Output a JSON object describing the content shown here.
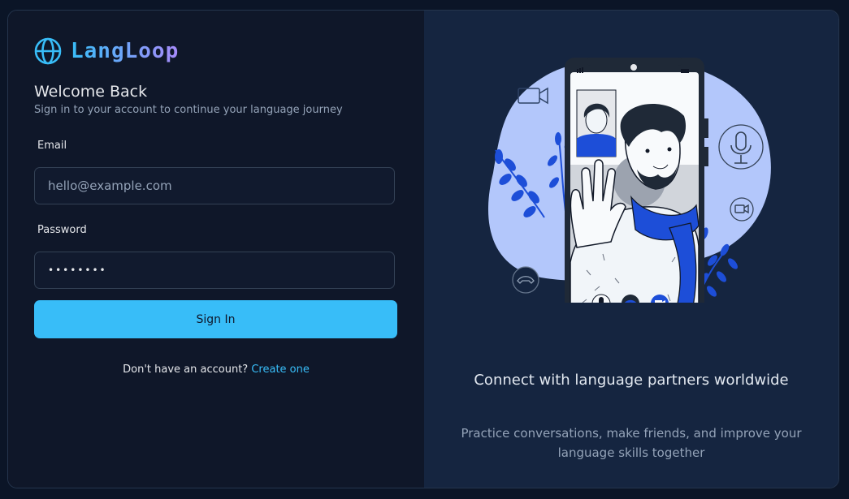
{
  "brand": {
    "name": "LangLoop",
    "icon": "globe-icon"
  },
  "login": {
    "title": "Welcome Back",
    "subtitle": "Sign in to your account to continue your language journey",
    "email_label": "Email",
    "email_placeholder": "hello@example.com",
    "password_label": "Password",
    "password_value": "••••••••",
    "signin_label": "Sign In",
    "signup_prompt": "Don't have an account?",
    "signup_link": "Create one"
  },
  "promo": {
    "title": "Connect with language partners worldwide",
    "description": "Practice conversations, make friends, and improve your language skills together"
  },
  "colors": {
    "accent": "#38bdf8",
    "panel_left": "#0f1729",
    "panel_right": "#152540",
    "blob": "#b3c7fb",
    "brand_blue": "#1d4ed8"
  }
}
